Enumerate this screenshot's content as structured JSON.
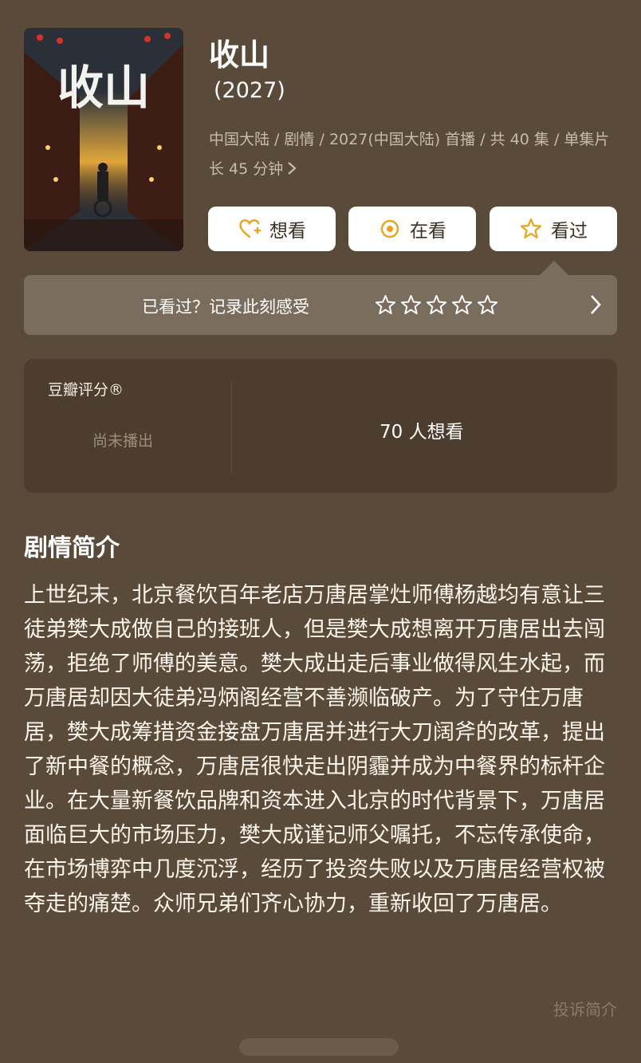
{
  "show": {
    "title": "收山",
    "year": "(2027)",
    "meta": "中国大陆 / 剧情 / 2027(中国大陆) 首播 / 共 40 集 / 单集片长 45 分钟"
  },
  "actions": {
    "want": "想看",
    "watching": "在看",
    "watched": "看过"
  },
  "rating_prompt": {
    "label": "已看过？记录此刻感受",
    "stars": 5
  },
  "score": {
    "title": "豆瓣评分®",
    "status": "尚未播出",
    "want_count": "70 人想看"
  },
  "synopsis": {
    "title": "剧情简介",
    "text": "上世纪末，北京餐饮百年老店万唐居掌灶师傅杨越均有意让三徒弟樊大成做自己的接班人，但是樊大成想离开万唐居出去闯荡，拒绝了师傅的美意。樊大成出走后事业做得风生水起，而万唐居却因大徒弟冯炳阁经营不善濒临破产。为了守住万唐居，樊大成筹措资金接盘万唐居并进行大刀阔斧的改革，提出了新中餐的概念，万唐居很快走出阴霾并成为中餐界的标杆企业。在大量新餐饮品牌和资本进入北京的时代背景下，万唐居面临巨大的市场压力，樊大成谨记师父嘱托，不忘传承使命，在市场博弈中几度沉浮，经历了投资失败以及万唐居经营权被夺走的痛楚。众师兄弟们齐心协力，重新收回了万唐居。",
    "report": "投诉简介"
  },
  "poster_text": "收山",
  "colors": {
    "background": "#5a4a3a",
    "card": "#4c3d2f",
    "rate_bar": "#7b6d5e",
    "accent_gold": "#e8a41c"
  }
}
